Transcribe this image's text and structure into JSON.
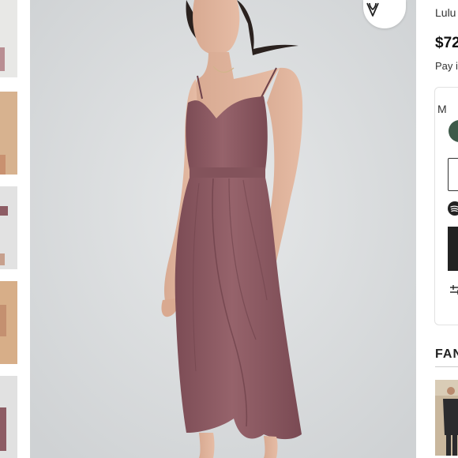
{
  "product": {
    "brand": "Lulu",
    "price": "$72",
    "pay_text": "Pay i"
  },
  "options": {
    "color_label": "M",
    "selected_color": "#3f5a4a"
  },
  "section": {
    "fan_title": "FAN"
  },
  "colors": {
    "dress": "#8d5c64",
    "background": "#dfe1e2"
  },
  "icons": {
    "brand_badge": "lulus-heart-logo-icon",
    "spotify": "spotify-icon",
    "filters": "sliders-icon"
  }
}
